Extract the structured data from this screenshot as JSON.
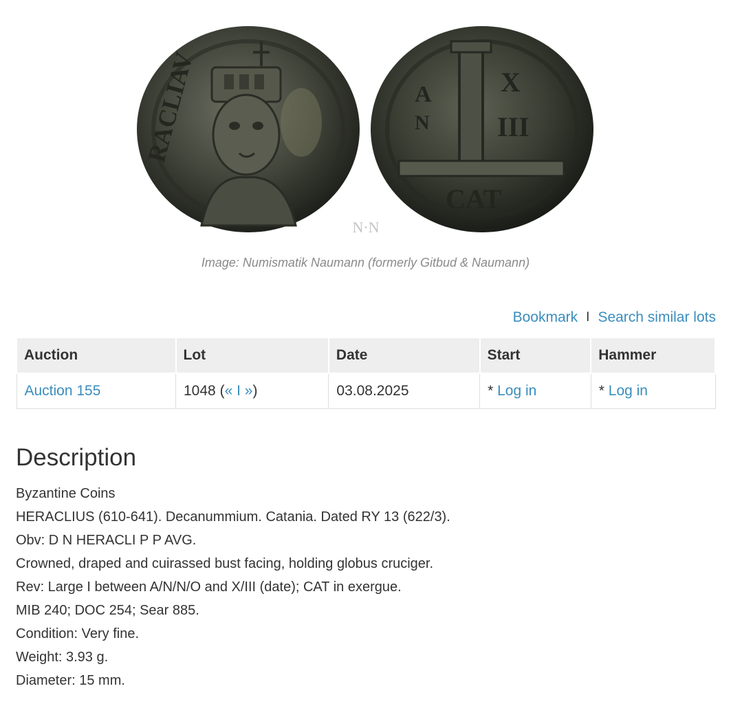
{
  "image": {
    "watermark": "N·N",
    "caption": "Image: Numismatik Naumann (formerly Gitbud & Naumann)"
  },
  "actions": {
    "bookmark": "Bookmark",
    "separator": "I",
    "search_similar": "Search similar lots"
  },
  "table": {
    "headers": [
      "Auction",
      "Lot",
      "Date",
      "Start",
      "Hammer"
    ],
    "row": {
      "auction": "Auction 155",
      "lot_number": "1048",
      "lot_open": "(",
      "prev": "«",
      "lot_sep": "I",
      "next": "»",
      "lot_close": ")",
      "date": "03.08.2025",
      "start_prefix": "*",
      "start_login": "Log in",
      "hammer_prefix": "*",
      "hammer_login": "Log in"
    }
  },
  "description": {
    "title": "Description",
    "lines": [
      "Byzantine Coins",
      "HERACLIUS (610-641). Decanummium. Catania. Dated RY 13 (622/3).",
      "Obv: D N HERACLI P P AVG.",
      "Crowned, draped and cuirassed bust facing, holding globus cruciger.",
      "Rev: Large I between A/N/N/O and X/III (date); CAT in exergue.",
      "MIB 240; DOC 254; Sear 885.",
      "Condition: Very fine.",
      "Weight: 3.93 g.",
      "Diameter: 15 mm."
    ]
  }
}
